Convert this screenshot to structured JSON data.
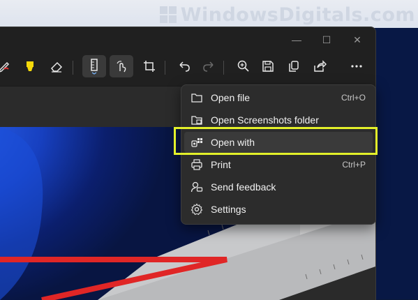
{
  "watermark": {
    "text": "WindowsDigitals.com"
  },
  "window": {
    "controls": {
      "minimize": "—",
      "maximize": "☐",
      "close": "✕"
    }
  },
  "toolbar": {
    "items": [
      {
        "name": "ballpoint-pen-icon"
      },
      {
        "name": "highlighter-icon"
      },
      {
        "name": "eraser-icon"
      },
      {
        "name": "ruler-icon"
      },
      {
        "name": "touch-writing-icon"
      },
      {
        "name": "crop-icon"
      },
      {
        "name": "undo-icon"
      },
      {
        "name": "redo-icon"
      },
      {
        "name": "zoom-in-icon"
      },
      {
        "name": "save-icon"
      },
      {
        "name": "copy-icon"
      },
      {
        "name": "share-icon"
      },
      {
        "name": "more-options-icon"
      }
    ],
    "highlighter_color": "#f5d90a",
    "pen_color": "#e23030"
  },
  "menu": {
    "items": [
      {
        "label": "Open file",
        "shortcut": "Ctrl+O",
        "icon": "folder-icon"
      },
      {
        "label": "Open Screenshots folder",
        "shortcut": "",
        "icon": "screenshots-folder-icon"
      },
      {
        "label": "Open with",
        "shortcut": "",
        "icon": "open-with-icon"
      },
      {
        "label": "Print",
        "shortcut": "Ctrl+P",
        "icon": "printer-icon"
      },
      {
        "label": "Send feedback",
        "shortcut": "",
        "icon": "feedback-icon"
      },
      {
        "label": "Settings",
        "shortcut": "",
        "icon": "gear-icon"
      }
    ]
  },
  "highlight_color": "#e3f02a"
}
